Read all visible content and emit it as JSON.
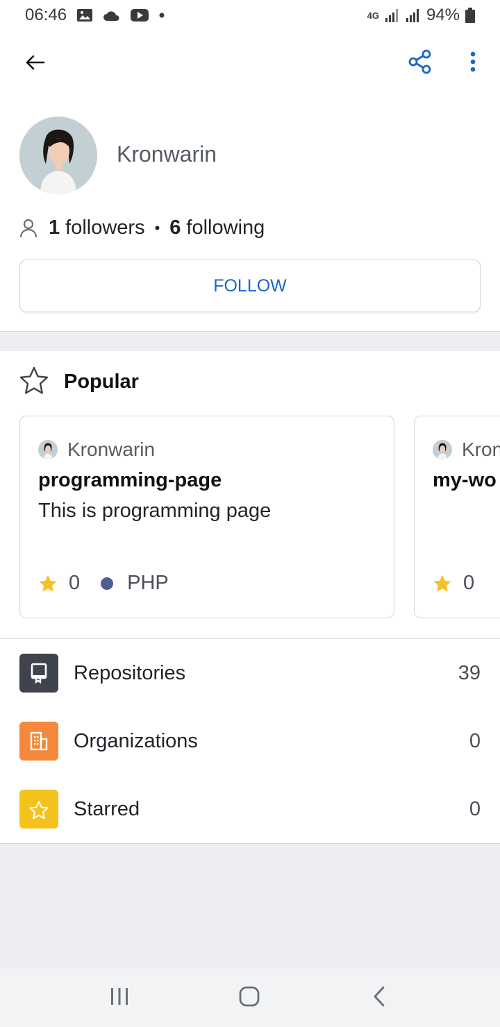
{
  "status_bar": {
    "time": "06:46",
    "network": "4G",
    "battery": "94%"
  },
  "appbar": {
    "back_icon": "arrow-left-icon",
    "share_icon": "share-icon",
    "more_icon": "more-vertical-icon",
    "accent_color": "#1a66c7"
  },
  "profile": {
    "name": "Kronwarin",
    "followers_count": "1",
    "followers_label": "followers",
    "separator": "•",
    "following_count": "6",
    "following_label": "following",
    "follow_button": "FOLLOW"
  },
  "popular": {
    "title": "Popular",
    "cards": [
      {
        "owner": "Kronwarin",
        "title": "programming-page",
        "description": "This is programming page",
        "stars": "0",
        "language": "PHP",
        "language_color": "#4f5d95"
      },
      {
        "owner": "Kronwarin",
        "title": "my-wo",
        "stars": "0"
      }
    ]
  },
  "menu": {
    "items": [
      {
        "label": "Repositories",
        "count": "39",
        "icon": "repository-icon",
        "color": "#3f434d"
      },
      {
        "label": "Organizations",
        "count": "0",
        "icon": "organization-icon",
        "color": "#f5883a"
      },
      {
        "label": "Starred",
        "count": "0",
        "icon": "star-icon",
        "color": "#f4c21c"
      }
    ]
  }
}
